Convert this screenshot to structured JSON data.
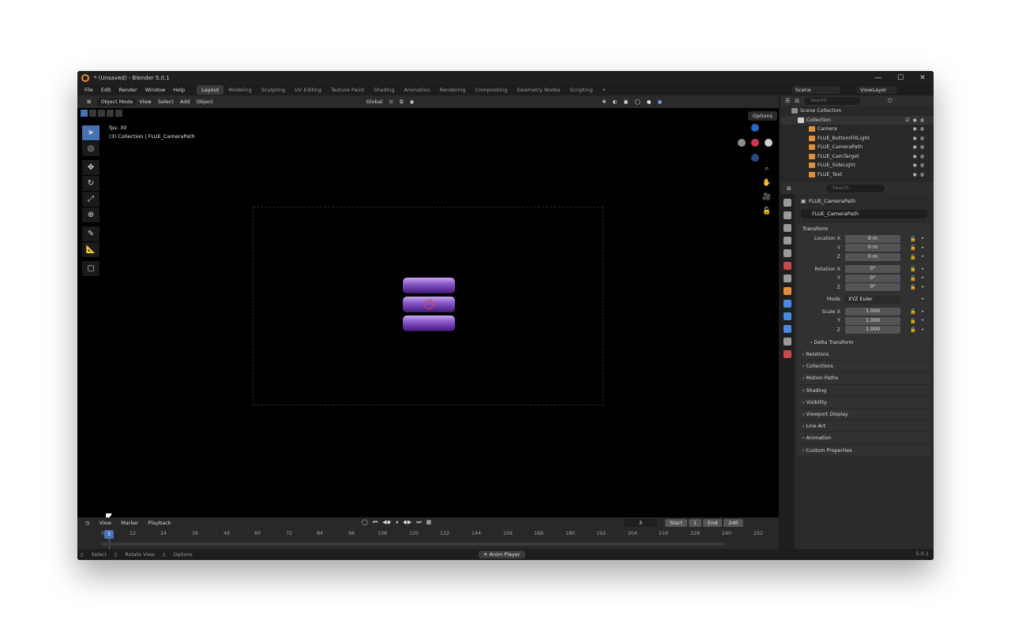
{
  "window": {
    "title": "* (Unsaved) - Blender 5.0.1",
    "min": "—",
    "max": "☐",
    "close": "✕"
  },
  "menu": [
    "File",
    "Edit",
    "Render",
    "Window",
    "Help"
  ],
  "workspaces": [
    "Layout",
    "Modeling",
    "Sculpting",
    "UV Editing",
    "Texture Paint",
    "Shading",
    "Animation",
    "Rendering",
    "Compositing",
    "Geometry Nodes",
    "Scripting",
    "+"
  ],
  "scene": {
    "name": "Scene",
    "view_layer": "ViewLayer"
  },
  "viewport_header": {
    "mode": "Object Mode",
    "view": "View",
    "select": "Select",
    "add": "Add",
    "object": "Object",
    "orientation": "Global"
  },
  "viewport": {
    "fps": "fps: 30",
    "collection_info": "(3) Collection | FLUE_CameraPath",
    "options": "Options"
  },
  "outliner": {
    "search_placeholder": "Search",
    "scene_collection": "Scene Collection",
    "collection": "Collection",
    "items": [
      "Camera",
      "FLUE_BottomFillLight",
      "FLUE_CameraPath",
      "FLUE_CamTarget",
      "FLUE_SideLight",
      "FLUE_Text"
    ]
  },
  "properties": {
    "search_placeholder": "Search",
    "object_name": "FLUE_CameraPath",
    "data_name": "FLUE_CameraPath",
    "transform": "Transform",
    "location": {
      "label_x": "Location X",
      "x": "0 m",
      "y": "0 m",
      "z": "0 m"
    },
    "rotation": {
      "label_x": "Rotation X",
      "x": "0°",
      "y": "0°",
      "z": "0°"
    },
    "mode_label": "Mode",
    "mode_value": "XYZ Euler",
    "scale": {
      "label_x": "Scale X",
      "x": "1.000",
      "y": "1.000",
      "z": "1.000"
    },
    "axis_y": "Y",
    "axis_z": "Z",
    "delta_transform": "Delta Transform",
    "panels": [
      "Relations",
      "Collections",
      "Motion Paths",
      "Shading",
      "Visibility",
      "Viewport Display",
      "Line Art",
      "Animation",
      "Custom Properties"
    ]
  },
  "timeline": {
    "view": "View",
    "marker": "Marker",
    "playback": "Playback",
    "current_frame": "3",
    "current_frame_marker": "3",
    "start_label": "Start",
    "start": "1",
    "end_label": "End",
    "end": "240",
    "ticks": [
      "0",
      "12",
      "24",
      "36",
      "48",
      "60",
      "72",
      "84",
      "96",
      "108",
      "120",
      "132",
      "144",
      "156",
      "168",
      "180",
      "192",
      "204",
      "216",
      "228",
      "240",
      "252"
    ]
  },
  "statusbar": {
    "select": "Select",
    "rotate_view": "Rotate View",
    "options": "Options",
    "anim_player": "Anim Player",
    "version": "5.0.1"
  },
  "colors": {
    "accent": "#4772b3",
    "object": "#8a5cc8",
    "origin": "#e04040"
  }
}
